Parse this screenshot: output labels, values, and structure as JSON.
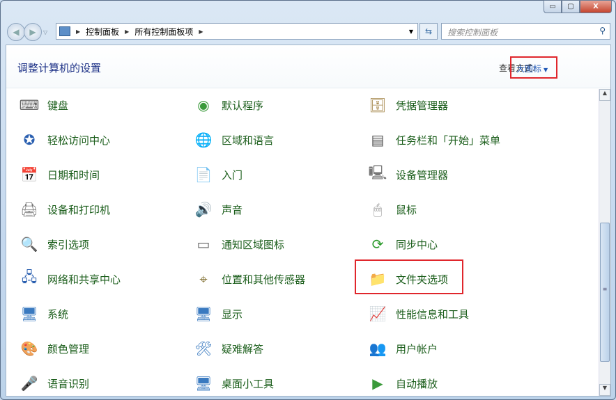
{
  "window": {
    "min_label": "▭",
    "max_label": "▢",
    "close_label": "X"
  },
  "nav": {
    "back": "◀",
    "forward": "▶",
    "dropdown": "▽"
  },
  "breadcrumb": [
    "控制面板",
    "所有控制面板项"
  ],
  "search": {
    "placeholder": "搜索控制面板",
    "icon": "search-icon"
  },
  "header": {
    "title": "调整计算机的设置",
    "view_by_label": "查看方式:",
    "view_by_value": "大图标"
  },
  "columns": [
    [
      {
        "label": "键盘",
        "icon": "⌨",
        "color": "#666"
      },
      {
        "label": "轻松访问中心",
        "icon": "✪",
        "color": "#2a5fb0"
      },
      {
        "label": "日期和时间",
        "icon": "📅",
        "color": "#4a8ad0"
      },
      {
        "label": "设备和打印机",
        "icon": "🖨",
        "color": "#777"
      },
      {
        "label": "索引选项",
        "icon": "🔍",
        "color": "#888"
      },
      {
        "label": "网络和共享中心",
        "icon": "🖧",
        "color": "#2a5fb0"
      },
      {
        "label": "系统",
        "icon": "🖥",
        "color": "#3a7ac0"
      },
      {
        "label": "颜色管理",
        "icon": "🎨",
        "color": "#c04"
      },
      {
        "label": "语音识别",
        "icon": "🎤",
        "color": "#888"
      }
    ],
    [
      {
        "label": "默认程序",
        "icon": "◉",
        "color": "#3a9a3a"
      },
      {
        "label": "区域和语言",
        "icon": "🌐",
        "color": "#2a6ab0"
      },
      {
        "label": "入门",
        "icon": "📄",
        "color": "#5aa0d0"
      },
      {
        "label": "声音",
        "icon": "🔊",
        "color": "#888"
      },
      {
        "label": "通知区域图标",
        "icon": "▭",
        "color": "#666"
      },
      {
        "label": "位置和其他传感器",
        "icon": "⌖",
        "color": "#8a7a40"
      },
      {
        "label": "显示",
        "icon": "🖥",
        "color": "#3a7ac0"
      },
      {
        "label": "疑难解答",
        "icon": "🛠",
        "color": "#3a7ac0"
      },
      {
        "label": "桌面小工具",
        "icon": "🖥",
        "color": "#3a7ac0"
      }
    ],
    [
      {
        "label": "凭据管理器",
        "icon": "🗄",
        "color": "#a08040"
      },
      {
        "label": "任务栏和「开始」菜单",
        "icon": "▤",
        "color": "#555"
      },
      {
        "label": "设备管理器",
        "icon": "🖳",
        "color": "#777"
      },
      {
        "label": "鼠标",
        "icon": "🖱",
        "color": "#888"
      },
      {
        "label": "同步中心",
        "icon": "⟳",
        "color": "#2a9a2a"
      },
      {
        "label": "文件夹选项",
        "icon": "📁",
        "color": "#d0a030"
      },
      {
        "label": "性能信息和工具",
        "icon": "📈",
        "color": "#2a8a2a"
      },
      {
        "label": "用户帐户",
        "icon": "👥",
        "color": "#5a8a3a"
      },
      {
        "label": "自动播放",
        "icon": "▶",
        "color": "#3a9a3a"
      }
    ]
  ],
  "scrollbar": {
    "position_fraction": 0.6
  }
}
